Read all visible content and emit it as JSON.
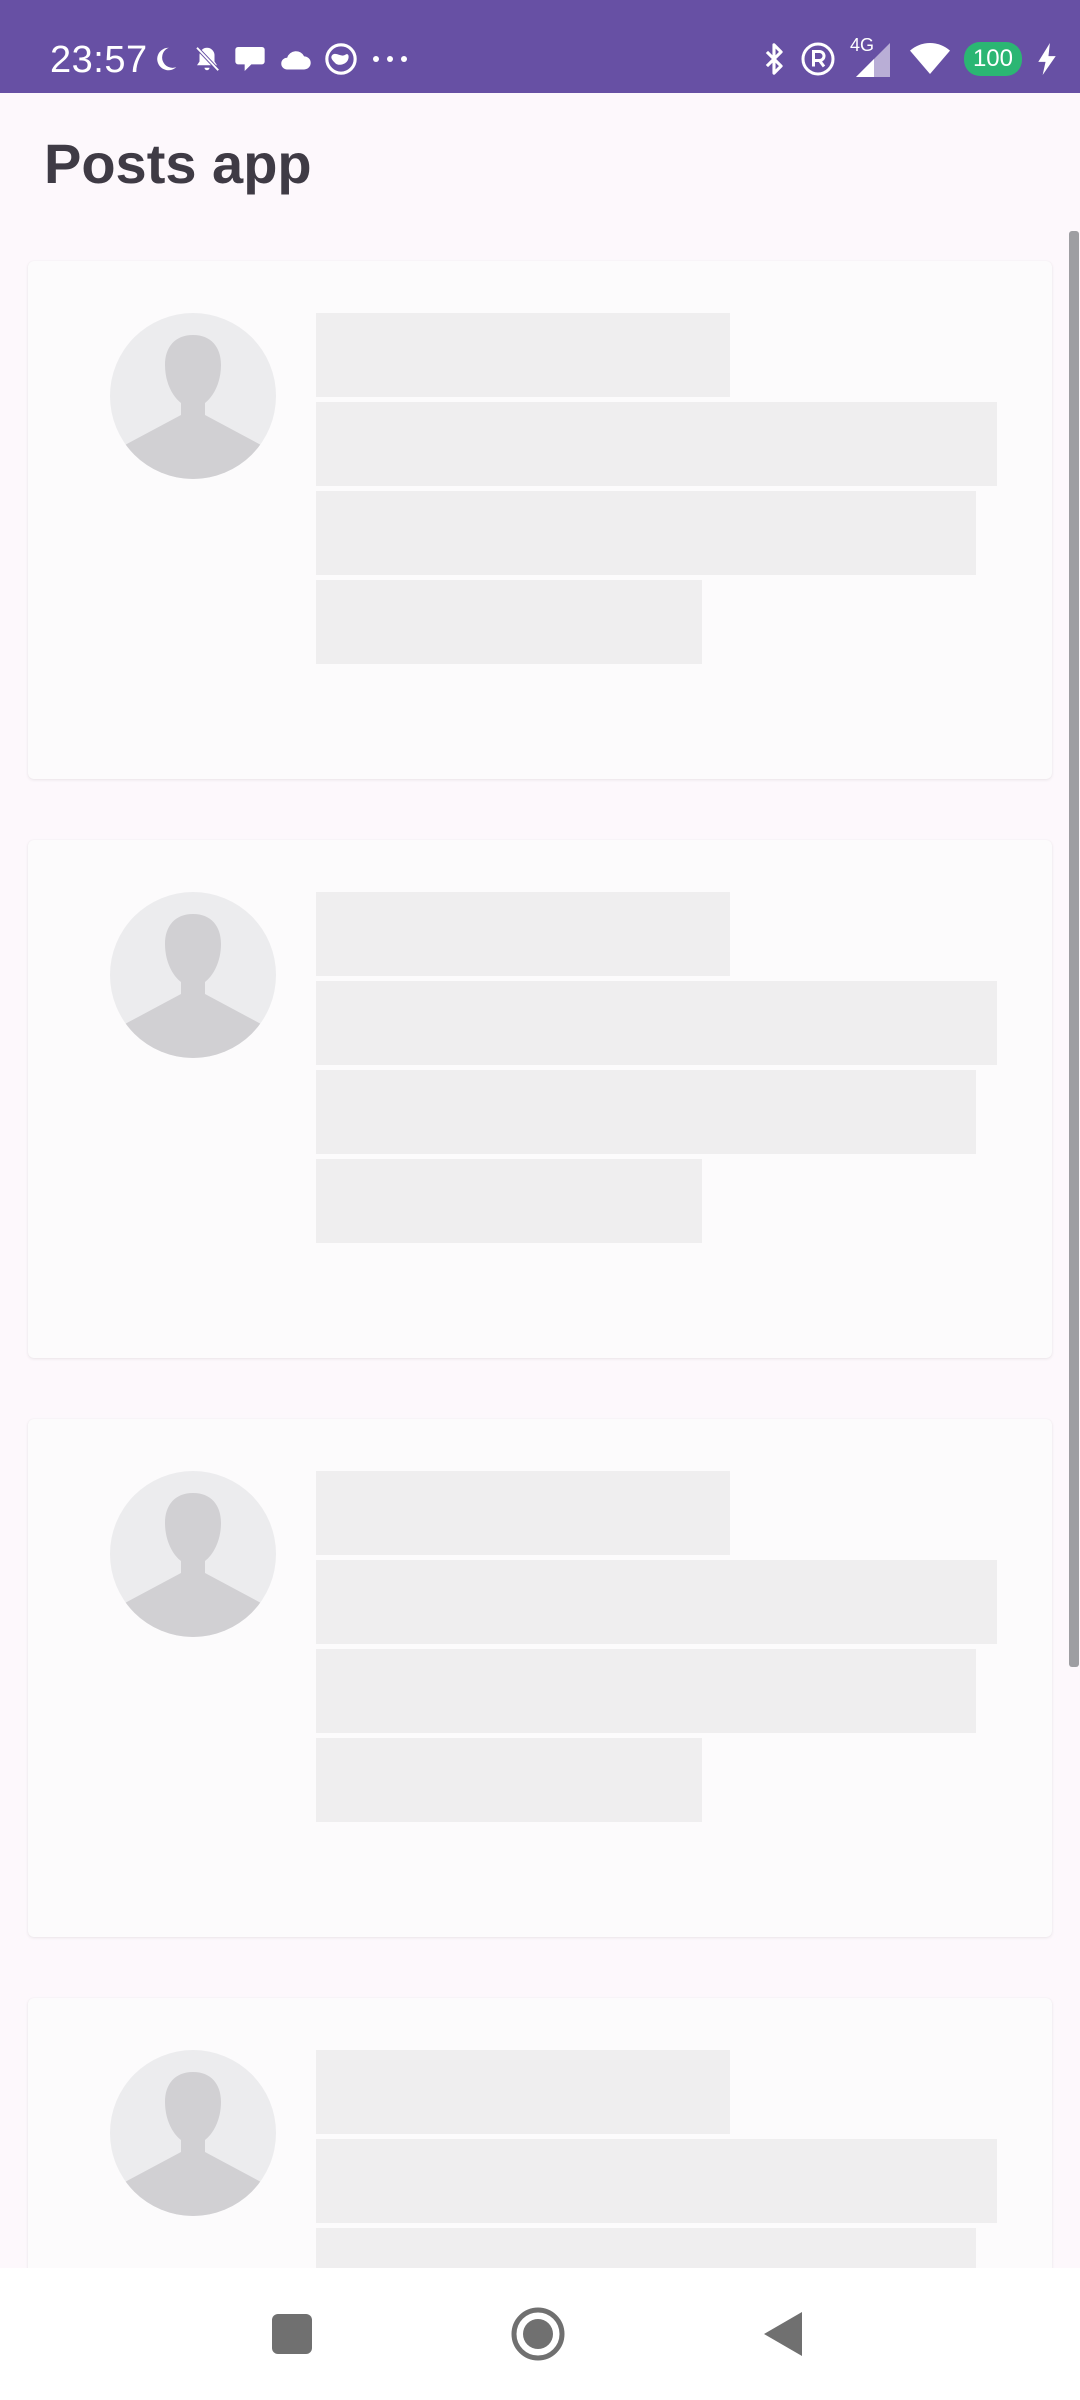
{
  "status_bar": {
    "time": "23:57",
    "network_label": "4G",
    "battery_level": "100",
    "left_icons": [
      "moon-icon",
      "muted-bell-icon",
      "chat-icon",
      "cloud-icon",
      "vpn-globe-icon",
      "more-dots-icon"
    ],
    "right_icons": [
      "bluetooth-icon",
      "registered-icon",
      "signal-icon",
      "wifi-icon",
      "battery-icon",
      "charging-bolt-icon"
    ],
    "background_color": "#6750a4",
    "battery_color": "#2bb673"
  },
  "app_bar": {
    "title": "Posts app"
  },
  "posts_list": {
    "state": "loading-skeleton",
    "placeholder_count": 4,
    "placeholder_color": "#efeeef",
    "avatar_color": "#ececee"
  },
  "nav_bar": {
    "buttons": [
      "recents-button",
      "home-button",
      "back-button"
    ]
  }
}
